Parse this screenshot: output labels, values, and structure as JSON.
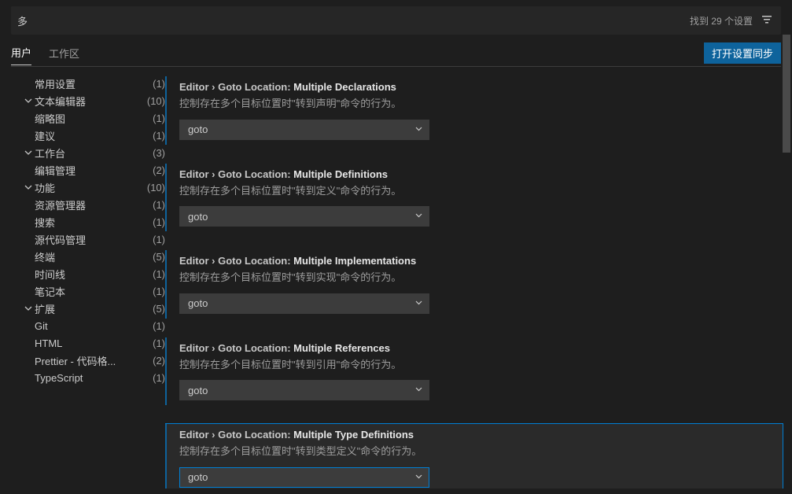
{
  "search": {
    "value": "多",
    "count_label": "找到 29 个设置"
  },
  "tabs": {
    "user": "用户",
    "workspace": "工作区"
  },
  "sync_button": "打开设置同步",
  "sidebar": {
    "items": [
      {
        "label": "常用设置",
        "count": "(1)",
        "chev": "",
        "indent": 0
      },
      {
        "label": "文本编辑器",
        "count": "(10)",
        "chev": "down",
        "indent": 0
      },
      {
        "label": "缩略图",
        "count": "(1)",
        "chev": "",
        "indent": 1
      },
      {
        "label": "建议",
        "count": "(1)",
        "chev": "",
        "indent": 1
      },
      {
        "label": "工作台",
        "count": "(3)",
        "chev": "down",
        "indent": 0
      },
      {
        "label": "编辑管理",
        "count": "(2)",
        "chev": "",
        "indent": 1
      },
      {
        "label": "功能",
        "count": "(10)",
        "chev": "down",
        "indent": 0
      },
      {
        "label": "资源管理器",
        "count": "(1)",
        "chev": "",
        "indent": 1
      },
      {
        "label": "搜索",
        "count": "(1)",
        "chev": "",
        "indent": 1
      },
      {
        "label": "源代码管理",
        "count": "(1)",
        "chev": "",
        "indent": 1
      },
      {
        "label": "终端",
        "count": "(5)",
        "chev": "",
        "indent": 1
      },
      {
        "label": "时间线",
        "count": "(1)",
        "chev": "",
        "indent": 1
      },
      {
        "label": "笔记本",
        "count": "(1)",
        "chev": "",
        "indent": 1
      },
      {
        "label": "扩展",
        "count": "(5)",
        "chev": "down",
        "indent": 0
      },
      {
        "label": "Git",
        "count": "(1)",
        "chev": "",
        "indent": 1
      },
      {
        "label": "HTML",
        "count": "(1)",
        "chev": "",
        "indent": 1
      },
      {
        "label": "Prettier - 代码格...",
        "count": "(2)",
        "chev": "",
        "indent": 1
      },
      {
        "label": "TypeScript",
        "count": "(1)",
        "chev": "",
        "indent": 1
      }
    ]
  },
  "settings": [
    {
      "path": "Editor › Goto Location: ",
      "name": "Multiple Declarations",
      "desc": "控制存在多个目标位置时\"转到声明\"命令的行为。",
      "value": "goto",
      "modified": true,
      "focused": false
    },
    {
      "path": "Editor › Goto Location: ",
      "name": "Multiple Definitions",
      "desc": "控制存在多个目标位置时\"转到定义\"命令的行为。",
      "value": "goto",
      "modified": true,
      "focused": false
    },
    {
      "path": "Editor › Goto Location: ",
      "name": "Multiple Implementations",
      "desc": "控制存在多个目标位置时\"转到实现\"命令的行为。",
      "value": "goto",
      "modified": true,
      "focused": false
    },
    {
      "path": "Editor › Goto Location: ",
      "name": "Multiple References",
      "desc": "控制存在多个目标位置时\"转到引用\"命令的行为。",
      "value": "goto",
      "modified": true,
      "focused": false
    },
    {
      "path": "Editor › Goto Location: ",
      "name": "Multiple Type Definitions",
      "desc": "控制存在多个目标位置时\"转到类型定义\"命令的行为。",
      "value": "goto",
      "modified": true,
      "focused": true
    }
  ]
}
